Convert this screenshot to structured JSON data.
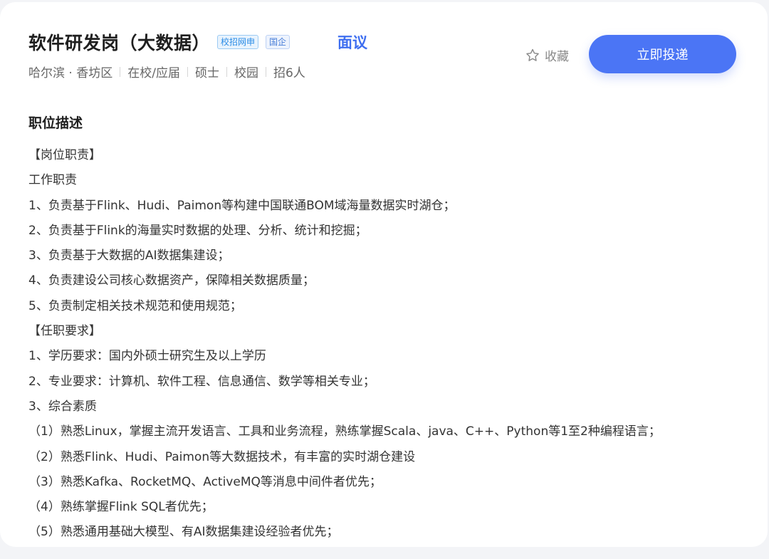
{
  "job": {
    "title": "软件研发岗（大数据）",
    "tags": [
      "校招网申",
      "国企"
    ],
    "salary": "面议",
    "meta": [
      "哈尔滨 · 香坊区",
      "在校/应届",
      "硕士",
      "校园",
      "招6人"
    ],
    "favorite_label": "收藏",
    "apply_label": "立即投递"
  },
  "description": {
    "heading": "职位描述",
    "lines": [
      "【岗位职责】",
      "工作职责",
      "1、负责基于Flink、Hudi、Paimon等构建中国联通BOM域海量数据实时湖仓；",
      "2、负责基于Flink的海量实时数据的处理、分析、统计和挖掘；",
      "3、负责基于大数据的AI数据集建设；",
      "4、负责建设公司核心数据资产，保障相关数据质量；",
      "5、负责制定相关技术规范和使用规范；",
      "【任职要求】",
      "1、学历要求：国内外硕士研究生及以上学历",
      "2、专业要求：计算机、软件工程、信息通信、数学等相关专业；",
      "3、综合素质",
      "（1）熟悉Linux，掌握主流开发语言、工具和业务流程，熟练掌握Scala、java、C++、Python等1至2种编程语言；",
      "（2）熟悉Flink、Hudi、Paimon等大数据技术，有丰富的实时湖仓建设",
      "（3）熟悉Kafka、RocketMQ、ActiveMQ等消息中间件者优先；",
      "（4）熟练掌握Flink SQL者优先；",
      "（5）熟悉通用基础大模型、有AI数据集建设经验者优先；"
    ]
  },
  "colors": {
    "accent": "#4b75f5",
    "salary": "#3f6ff0",
    "tag_blue": "#2b8ce6"
  },
  "icons": {
    "favorite": "star-outline-icon"
  }
}
